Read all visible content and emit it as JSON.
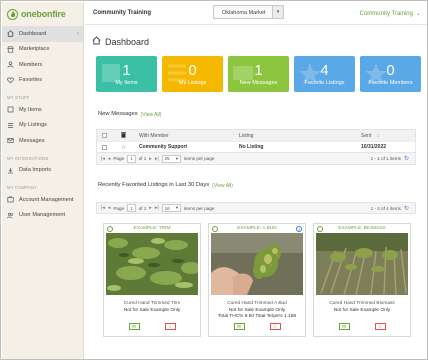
{
  "app": {
    "logo_one": "one",
    "logo_bonfire": "bonfire"
  },
  "topbar": {
    "title": "Community Training",
    "market": "Oklahoma Market",
    "account": "Community Training"
  },
  "sidebar": {
    "items": [
      {
        "label": "Dashboard",
        "icon": "home-icon"
      },
      {
        "label": "Marketplace",
        "icon": "marketplace-icon"
      },
      {
        "label": "Members",
        "icon": "members-icon"
      },
      {
        "label": "Favorites",
        "icon": "heart-icon"
      }
    ],
    "section_stuff": "MY STUFF",
    "stuff_items": [
      {
        "label": "My Items",
        "icon": "items-icon"
      },
      {
        "label": "My Listings",
        "icon": "listings-icon"
      },
      {
        "label": "Messages",
        "icon": "messages-icon"
      }
    ],
    "section_integrations": "MY INTEGRATIONS",
    "integration_items": [
      {
        "label": "Data Imports",
        "icon": "data-imports-icon"
      }
    ],
    "section_company": "MY COMPANY",
    "company_items": [
      {
        "label": "Account Management",
        "icon": "account-icon"
      },
      {
        "label": "User Management",
        "icon": "users-icon"
      }
    ]
  },
  "dashboard": {
    "title": "Dashboard",
    "cards": [
      {
        "num": "1",
        "label": "My Items",
        "color": "#3bbfa5"
      },
      {
        "num": "0",
        "label": "My Listings",
        "color": "#f5b800"
      },
      {
        "num": "1",
        "label": "New Messages",
        "color": "#8cc63e"
      },
      {
        "num": "4",
        "label": "Favorite Listings",
        "color": "#5aa8e6"
      },
      {
        "num": "0",
        "label": "Favorite Members",
        "color": "#5aa8e6"
      }
    ]
  },
  "messages": {
    "title": "New Messages",
    "view_all": "(View All)",
    "columns": [
      "With Member",
      "Listing",
      "Sent"
    ],
    "rows": [
      {
        "member": "Community Support",
        "listing": "No Listing",
        "sent": "10/31/2022"
      }
    ],
    "pager": {
      "page_label": "Page",
      "page": "1",
      "of": "of 1",
      "per_page": "25",
      "per_page_label": "items per page",
      "count": "1 - 1 of 1 items"
    }
  },
  "favorites": {
    "title": "Recently Favorited Listings in Last 30 Days",
    "view_all": "(View All)",
    "pager": {
      "page_label": "Page",
      "page": "1",
      "of": "of 1",
      "per_page": "16",
      "per_page_label": "items per page",
      "count": "1 - 4 of 4 items"
    },
    "cards": [
      {
        "title": "EXAMPLE: TRIM",
        "name": "Cured Hand Trimmed Trim",
        "sub": "Not for Sale Example Only",
        "extra": ""
      },
      {
        "title": "EXAMPLE: A BUD",
        "name": "Cured Hand Trimmed A Bud",
        "sub": "Not for Sale Example Only",
        "extra": "Total THC% 8.50  Total Terps% 1.168"
      },
      {
        "title": "EXAMPLE: BIOMASS",
        "name": "Cured Hand Trimmed Biomass",
        "sub": "Not for Sale Example Only",
        "extra": ""
      }
    ]
  }
}
